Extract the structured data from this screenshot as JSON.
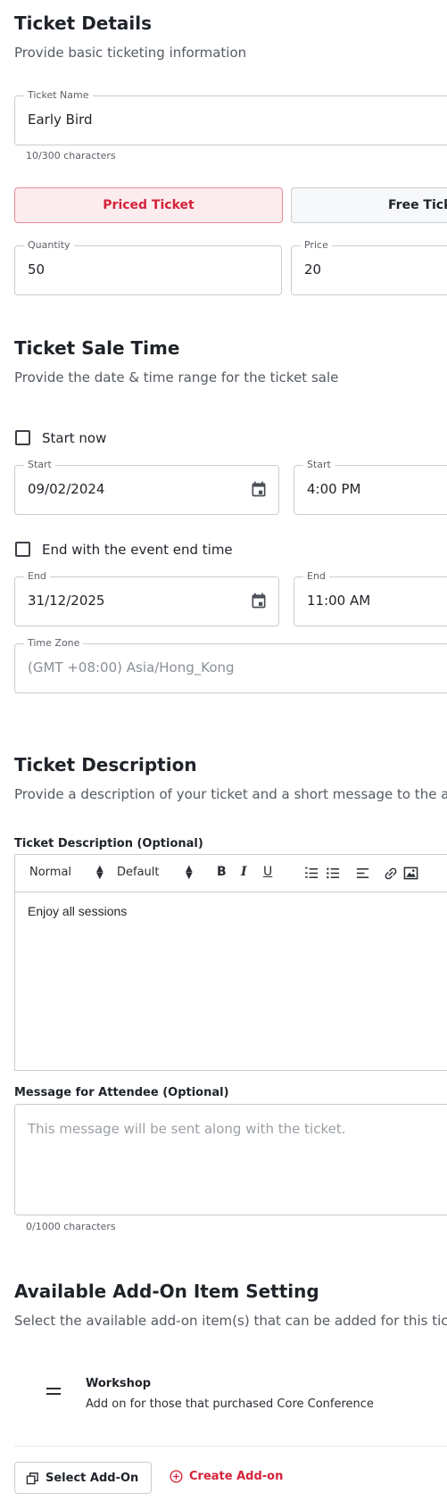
{
  "ticket_details": {
    "title": "Ticket Details",
    "subtitle": "Provide basic ticketing information",
    "name_label": "Ticket Name",
    "name_value": "Early Bird",
    "name_counter": "10/300 characters",
    "priced_label": "Priced Ticket",
    "free_label": "Free Tick",
    "quantity_label": "Quantity",
    "quantity_value": "50",
    "price_label": "Price",
    "price_value": "20"
  },
  "sale_time": {
    "title": "Ticket Sale Time",
    "subtitle": "Provide the date & time range for the ticket sale",
    "start_now_label": "Start now",
    "start_date_label": "Start",
    "start_date_value": "09/02/2024",
    "start_time_label": "Start",
    "start_time_value": "4:00 PM",
    "end_with_event_label": "End with the event end time",
    "end_date_label": "End",
    "end_date_value": "31/12/2025",
    "end_time_label": "End",
    "end_time_value": "11:00 AM",
    "timezone_label": "Time Zone",
    "timezone_value": "(GMT +08:00) Asia/Hong_Kong"
  },
  "description": {
    "title": "Ticket Description",
    "subtitle": "Provide a description of your ticket and a short message to the a",
    "desc_label": "Ticket Description (Optional)",
    "toolbar": {
      "format": "Normal",
      "font": "Default",
      "bold": "B",
      "italic": "I",
      "underline": "U"
    },
    "desc_value": "Enjoy all sessions",
    "message_label": "Message for Attendee (Optional)",
    "message_placeholder": "This message will be sent along with the ticket.",
    "message_counter": "0/1000 characters"
  },
  "addons": {
    "title": "Available Add-On Item Setting",
    "subtitle": "Select the available add-on item(s) that can be added for this tic",
    "items": [
      {
        "name": "Workshop",
        "description": "Add on for those that purchased Core Conference"
      }
    ],
    "select_button": "Select Add-On",
    "create_button": "Create Add-on"
  },
  "colors": {
    "accent": "#d5233a",
    "accent_bg": "#fdecee",
    "border": "#c9ccd1"
  }
}
